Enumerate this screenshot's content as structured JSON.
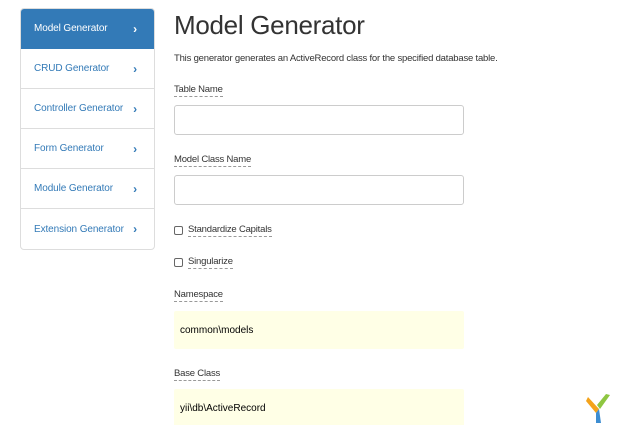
{
  "sidebar": {
    "items": [
      {
        "label": "Model Generator",
        "active": true
      },
      {
        "label": "CRUD Generator",
        "active": false
      },
      {
        "label": "Controller Generator",
        "active": false
      },
      {
        "label": "Form Generator",
        "active": false
      },
      {
        "label": "Module Generator",
        "active": false
      },
      {
        "label": "Extension Generator",
        "active": false
      }
    ],
    "chevron_icon": "chevron-right-icon"
  },
  "main": {
    "title": "Model Generator",
    "description": "This generator generates an ActiveRecord class for the specified database table.",
    "table_name": {
      "label": "Table Name",
      "value": ""
    },
    "model_class_name": {
      "label": "Model Class Name",
      "value": ""
    },
    "standardize_capitals": {
      "label": "Standardize Capitals",
      "checked": false
    },
    "singularize": {
      "label": "Singularize",
      "checked": false
    },
    "namespace": {
      "label": "Namespace",
      "value": "common\\models"
    },
    "base_class": {
      "label": "Base Class",
      "value": "yii\\db\\ActiveRecord"
    }
  },
  "colors": {
    "accent": "#337ab7",
    "sticky_bg": "#ffffe6",
    "logo_green": "#8ec641",
    "logo_blue": "#3d8dd1",
    "logo_orange": "#f4a31b"
  }
}
